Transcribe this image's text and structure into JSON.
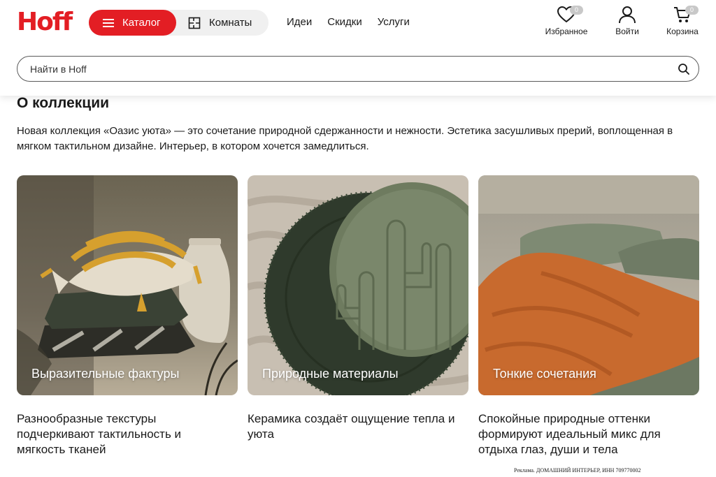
{
  "header": {
    "logo": "Hoff",
    "catalog_label": "Каталог",
    "rooms_label": "Комнаты",
    "nav": [
      "Идеи",
      "Скидки",
      "Услуги"
    ],
    "favorites": {
      "label": "Избранное",
      "count": "0"
    },
    "login": {
      "label": "Войти"
    },
    "cart": {
      "label": "Корзина",
      "count": "0"
    }
  },
  "search": {
    "placeholder": "Найти в Hoff"
  },
  "collection": {
    "title": "О коллекции",
    "description": "Новая коллекция «Оазис уюта» — это сочетание природной сдержанности и нежности. Эстетика засушливых прерий, воплощенная в мягком тактильном дизайне. Интерьер, в котором хочется замедлиться.",
    "cards": [
      {
        "title": "Выразительные фактуры",
        "text": "Разнообразные текстуры подчеркивают тактильность и мягкость тканей"
      },
      {
        "title": "Природные материалы",
        "text": "Керамика создаёт ощущение тепла и уюта"
      },
      {
        "title": "Тонкие сочетания",
        "text": "Спокойные природные оттенки формируют идеальный микс для отдыха глаз, души и тела"
      }
    ]
  },
  "ad_note": "Реклама. ДОМАШНИЙ ИНТЕРЬЕР, ИНН 709770002",
  "colors": {
    "brand_red": "#e31e24",
    "text": "#1a1a1a",
    "pill_bg": "#f0f0f0"
  }
}
